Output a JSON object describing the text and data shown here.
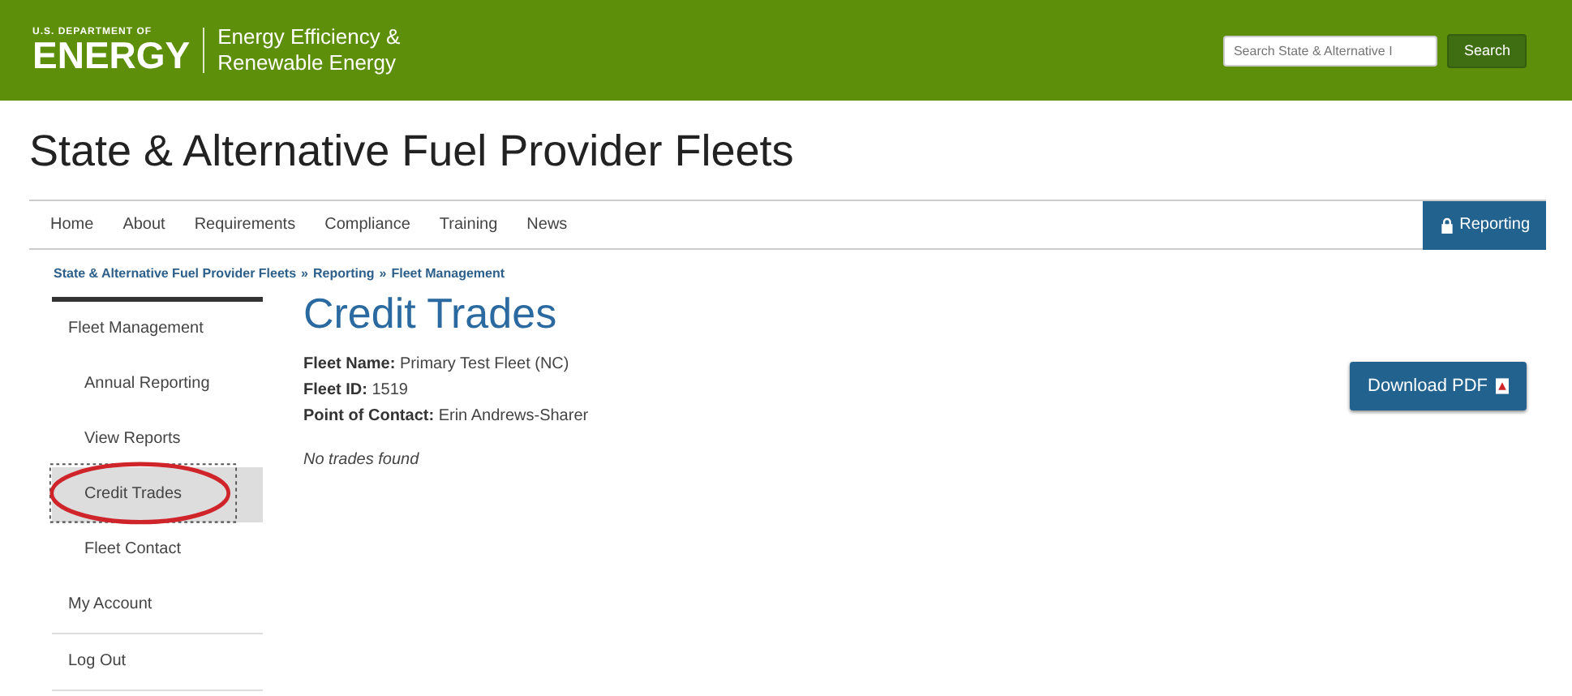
{
  "header": {
    "logo_top": "U.S. DEPARTMENT OF",
    "logo_main": "ENERGY",
    "office_line_1": "Energy Efficiency &",
    "office_line_2": "Renewable Energy",
    "search": {
      "placeholder": "Search State & Alternative I",
      "button": "Search"
    }
  },
  "site_title": "State & Alternative Fuel Provider Fleets",
  "nav": [
    {
      "label": "Home",
      "selected": false
    },
    {
      "label": "About",
      "selected": false
    },
    {
      "label": "Requirements",
      "selected": false
    },
    {
      "label": "Compliance",
      "selected": false
    },
    {
      "label": "Training",
      "selected": false
    },
    {
      "label": "News",
      "selected": false
    },
    {
      "label": "Reporting",
      "selected": true,
      "kind": "locked"
    }
  ],
  "breadcrumb": {
    "separator": "»",
    "links": [
      "State & Alternative Fuel Provider Fleets",
      "Reporting",
      "Fleet Management"
    ]
  },
  "sidebar": {
    "items": [
      {
        "label": "Fleet Management",
        "selected": false,
        "children": [
          {
            "label": "Annual Reporting",
            "selected": false
          },
          {
            "label": "View Reports",
            "selected": false
          },
          {
            "label": "Credit Trades",
            "selected": true
          },
          {
            "label": "Fleet Contact",
            "selected": false
          }
        ]
      },
      {
        "label": "My Account",
        "selected": false
      },
      {
        "label": "Log Out",
        "selected": false
      }
    ]
  },
  "content": {
    "title": "Credit Trades",
    "fields": [
      {
        "label": "Fleet Name:",
        "value": "Primary Test Fleet (NC)"
      },
      {
        "label": "Fleet ID:",
        "value": "1519"
      },
      {
        "label": "Point of Contact:",
        "value": "Erin Andrews-Sharer"
      }
    ],
    "empty_message": "No trades found",
    "download_button": "Download PDF"
  }
}
